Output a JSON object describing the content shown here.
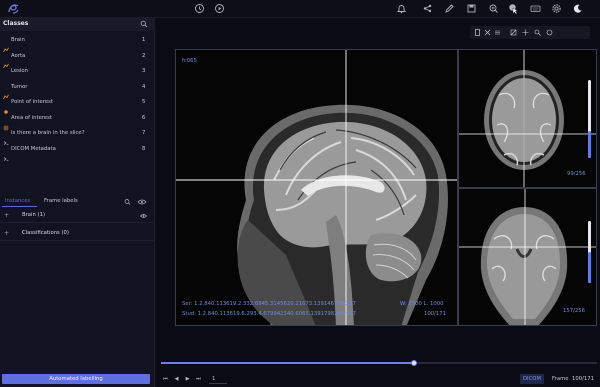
{
  "app": {
    "accent": "#5e6fe0"
  },
  "topbar": {
    "icons": [
      "logo-icon",
      "clock-icon",
      "play-icon",
      "bell-icon",
      "share-icon",
      "pencil-icon",
      "save-icon",
      "zoom-icon",
      "cursor-icon",
      "keyboard-icon",
      "settings-icon",
      "moon-icon"
    ]
  },
  "sidebar": {
    "classes_title": "Classes",
    "classes": [
      {
        "name": "Brain",
        "key": "1",
        "icon": "polyline-icon",
        "color": "#e58a3a"
      },
      {
        "name": "Aorta",
        "key": "2",
        "icon": "polyline-icon",
        "color": "#e58a3a"
      },
      {
        "name": "Lesion",
        "key": "3",
        "icon": "none",
        "color": "#c8cad4"
      },
      {
        "name": "Tumor",
        "key": "4",
        "icon": "polyline-icon",
        "color": "#e58a3a"
      },
      {
        "name": "Point of interest",
        "key": "5",
        "icon": "point-icon",
        "color": "#e58a3a"
      },
      {
        "name": "Area of interest",
        "key": "6",
        "icon": "grid-icon",
        "color": "#e58a3a"
      },
      {
        "name": "Is there a brain in the slice?",
        "key": "7",
        "icon": "question-icon",
        "color": "#c8cad4"
      },
      {
        "name": "DICOM Metadata",
        "key": "8",
        "icon": "metadata-icon",
        "color": "#c8cad4"
      }
    ],
    "tabs": {
      "instances": "Instances",
      "frame_labels": "Frame labels"
    },
    "instances": [
      {
        "name": "Brain (1)"
      },
      {
        "name": "Classifications (0)"
      }
    ],
    "auto_label": "Automated labelling"
  },
  "viewer": {
    "main_label_tl": "fc065",
    "main_info_line1": "Ser: 1.2.840.113619.2.332.6945.3145620.21673.1391467980.97",
    "main_info_line2": "Stud: 1.2.840.113619.6.293.4.679942340.6065.1391798290.007",
    "window_level": "W: 2500 L: 1000",
    "main_frame": "100/171",
    "axial_frame": "99/256",
    "coronal_frame": "157/256",
    "axial_slider": 0.35,
    "coronal_slider": 0.5
  },
  "player": {
    "frame_input": "1",
    "dicom": "DICOM",
    "frame_label": "Frame",
    "frame_count": "100/171",
    "progress": 0.58
  }
}
